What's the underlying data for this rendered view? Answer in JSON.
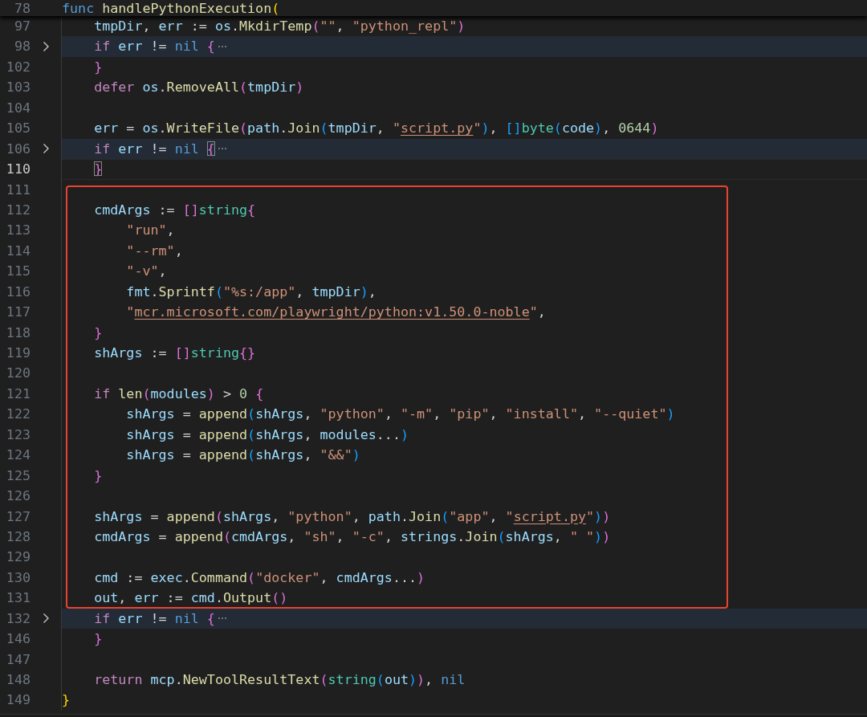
{
  "sticky_header": {
    "number": "78",
    "tokens": [
      {
        "text": "func ",
        "kind": "const"
      },
      {
        "text": "handlePythonExecution",
        "kind": "fn"
      },
      {
        "text": "(",
        "kind": "b1"
      }
    ]
  },
  "sections": [
    {
      "framed": false,
      "lines": [
        {
          "number": "97",
          "folded": false,
          "current": false,
          "tokens": [
            {
              "text": "    tmpDir",
              "kind": "var"
            },
            {
              "text": ", ",
              "kind": "plain"
            },
            {
              "text": "err",
              "kind": "var"
            },
            {
              "text": " := ",
              "kind": "plain"
            },
            {
              "text": "os",
              "kind": "var"
            },
            {
              "text": ".",
              "kind": "plain"
            },
            {
              "text": "MkdirTemp",
              "kind": "fn"
            },
            {
              "text": "(",
              "kind": "b2"
            },
            {
              "text": "\"\"",
              "kind": "str"
            },
            {
              "text": ", ",
              "kind": "plain"
            },
            {
              "text": "\"python_repl\"",
              "kind": "str"
            },
            {
              "text": ")",
              "kind": "b2"
            }
          ]
        },
        {
          "number": "98",
          "folded": true,
          "current": false,
          "tokens": [
            {
              "text": "    if ",
              "kind": "kw"
            },
            {
              "text": "err",
              "kind": "var"
            },
            {
              "text": " != ",
              "kind": "plain"
            },
            {
              "text": "nil ",
              "kind": "const"
            },
            {
              "text": "{",
              "kind": "b2"
            }
          ]
        },
        {
          "number": "102",
          "folded": false,
          "current": false,
          "tokens": [
            {
              "text": "    }",
              "kind": "b2"
            }
          ]
        },
        {
          "number": "103",
          "folded": false,
          "current": false,
          "tokens": [
            {
              "text": "    defer ",
              "kind": "kw"
            },
            {
              "text": "os",
              "kind": "var"
            },
            {
              "text": ".",
              "kind": "plain"
            },
            {
              "text": "RemoveAll",
              "kind": "fn"
            },
            {
              "text": "(",
              "kind": "b2"
            },
            {
              "text": "tmpDir",
              "kind": "var"
            },
            {
              "text": ")",
              "kind": "b2"
            }
          ]
        },
        {
          "number": "104",
          "folded": false,
          "current": false
        },
        {
          "number": "105",
          "folded": false,
          "current": false,
          "tokens": [
            {
              "text": "    err",
              "kind": "var"
            },
            {
              "text": " = ",
              "kind": "plain"
            },
            {
              "text": "os",
              "kind": "var"
            },
            {
              "text": ".",
              "kind": "plain"
            },
            {
              "text": "WriteFile",
              "kind": "fn"
            },
            {
              "text": "(",
              "kind": "b2"
            },
            {
              "text": "path",
              "kind": "var"
            },
            {
              "text": ".",
              "kind": "plain"
            },
            {
              "text": "Join",
              "kind": "fn"
            },
            {
              "text": "(",
              "kind": "b3"
            },
            {
              "text": "tmpDir",
              "kind": "var"
            },
            {
              "text": ", ",
              "kind": "plain"
            },
            {
              "text": "\"",
              "kind": "str"
            },
            {
              "text": "script.py",
              "kind": "link"
            },
            {
              "text": "\"",
              "kind": "str"
            },
            {
              "text": ")",
              "kind": "b3"
            },
            {
              "text": ", ",
              "kind": "plain"
            },
            {
              "text": "[]",
              "kind": "b3"
            },
            {
              "text": "byte",
              "kind": "type"
            },
            {
              "text": "(",
              "kind": "b3"
            },
            {
              "text": "code",
              "kind": "var"
            },
            {
              "text": ")",
              "kind": "b3"
            },
            {
              "text": ", ",
              "kind": "plain"
            },
            {
              "text": "0644",
              "kind": "num"
            },
            {
              "text": ")",
              "kind": "b2"
            }
          ]
        },
        {
          "number": "106",
          "folded": true,
          "current": false,
          "tokens": [
            {
              "text": "    if ",
              "kind": "kw"
            },
            {
              "text": "err",
              "kind": "var"
            },
            {
              "text": " != ",
              "kind": "plain"
            },
            {
              "text": "nil ",
              "kind": "const"
            },
            {
              "text": "{",
              "kind": "b2",
              "matched": true
            }
          ]
        },
        {
          "number": "110",
          "folded": false,
          "current": true,
          "tokens": [
            {
              "text": "    }",
              "kind": "b2",
              "matched": true
            }
          ]
        }
      ]
    },
    {
      "framed": true,
      "lines": [
        {
          "number": "111",
          "folded": false,
          "current": false
        },
        {
          "number": "112",
          "folded": false,
          "current": false,
          "tokens": [
            {
              "text": "    cmdArgs",
              "kind": "var"
            },
            {
              "text": " := ",
              "kind": "plain"
            },
            {
              "text": "[]",
              "kind": "b2"
            },
            {
              "text": "string",
              "kind": "type"
            },
            {
              "text": "{",
              "kind": "b2"
            }
          ]
        },
        {
          "number": "113",
          "folded": false,
          "current": false,
          "tokens": [
            {
              "text": "        \"run\"",
              "kind": "str"
            },
            {
              "text": ",",
              "kind": "plain"
            }
          ]
        },
        {
          "number": "114",
          "folded": false,
          "current": false,
          "tokens": [
            {
              "text": "        \"--rm\"",
              "kind": "str"
            },
            {
              "text": ",",
              "kind": "plain"
            }
          ]
        },
        {
          "number": "115",
          "folded": false,
          "current": false,
          "tokens": [
            {
              "text": "        \"-v\"",
              "kind": "str"
            },
            {
              "text": ",",
              "kind": "plain"
            }
          ]
        },
        {
          "number": "116",
          "folded": false,
          "current": false,
          "tokens": [
            {
              "text": "        fmt",
              "kind": "var"
            },
            {
              "text": ".",
              "kind": "plain"
            },
            {
              "text": "Sprintf",
              "kind": "fn"
            },
            {
              "text": "(",
              "kind": "b3"
            },
            {
              "text": "\"%s:/app\"",
              "kind": "str"
            },
            {
              "text": ", ",
              "kind": "plain"
            },
            {
              "text": "tmpDir",
              "kind": "var"
            },
            {
              "text": ")",
              "kind": "b3"
            },
            {
              "text": ",",
              "kind": "plain"
            }
          ]
        },
        {
          "number": "117",
          "folded": false,
          "current": false,
          "tokens": [
            {
              "text": "        \"",
              "kind": "str"
            },
            {
              "text": "mcr.microsoft.com/playwright/python:v1.50.0-noble",
              "kind": "link"
            },
            {
              "text": "\"",
              "kind": "str"
            },
            {
              "text": ",",
              "kind": "plain"
            }
          ]
        },
        {
          "number": "118",
          "folded": false,
          "current": false,
          "tokens": [
            {
              "text": "    }",
              "kind": "b2"
            }
          ]
        },
        {
          "number": "119",
          "folded": false,
          "current": false,
          "tokens": [
            {
              "text": "    shArgs",
              "kind": "var"
            },
            {
              "text": " := ",
              "kind": "plain"
            },
            {
              "text": "[]",
              "kind": "b2"
            },
            {
              "text": "string",
              "kind": "type"
            },
            {
              "text": "{}",
              "kind": "b2"
            }
          ]
        },
        {
          "number": "120",
          "folded": false,
          "current": false
        },
        {
          "number": "121",
          "folded": false,
          "current": false,
          "tokens": [
            {
              "text": "    if ",
              "kind": "kw"
            },
            {
              "text": "len",
              "kind": "fn"
            },
            {
              "text": "(",
              "kind": "b2"
            },
            {
              "text": "modules",
              "kind": "var"
            },
            {
              "text": ")",
              "kind": "b2"
            },
            {
              "text": " > ",
              "kind": "plain"
            },
            {
              "text": "0 ",
              "kind": "num"
            },
            {
              "text": "{",
              "kind": "b2"
            }
          ]
        },
        {
          "number": "122",
          "folded": false,
          "current": false,
          "tokens": [
            {
              "text": "        shArgs",
              "kind": "var"
            },
            {
              "text": " = ",
              "kind": "plain"
            },
            {
              "text": "append",
              "kind": "fn"
            },
            {
              "text": "(",
              "kind": "b3"
            },
            {
              "text": "shArgs",
              "kind": "var"
            },
            {
              "text": ", ",
              "kind": "plain"
            },
            {
              "text": "\"python\"",
              "kind": "str"
            },
            {
              "text": ", ",
              "kind": "plain"
            },
            {
              "text": "\"-m\"",
              "kind": "str"
            },
            {
              "text": ", ",
              "kind": "plain"
            },
            {
              "text": "\"pip\"",
              "kind": "str"
            },
            {
              "text": ", ",
              "kind": "plain"
            },
            {
              "text": "\"install\"",
              "kind": "str"
            },
            {
              "text": ", ",
              "kind": "plain"
            },
            {
              "text": "\"--quiet\"",
              "kind": "str"
            },
            {
              "text": ")",
              "kind": "b3"
            }
          ]
        },
        {
          "number": "123",
          "folded": false,
          "current": false,
          "tokens": [
            {
              "text": "        shArgs",
              "kind": "var"
            },
            {
              "text": " = ",
              "kind": "plain"
            },
            {
              "text": "append",
              "kind": "fn"
            },
            {
              "text": "(",
              "kind": "b3"
            },
            {
              "text": "shArgs",
              "kind": "var"
            },
            {
              "text": ", ",
              "kind": "plain"
            },
            {
              "text": "modules",
              "kind": "var"
            },
            {
              "text": "...",
              "kind": "plain"
            },
            {
              "text": ")",
              "kind": "b3"
            }
          ]
        },
        {
          "number": "124",
          "folded": false,
          "current": false,
          "tokens": [
            {
              "text": "        shArgs",
              "kind": "var"
            },
            {
              "text": " = ",
              "kind": "plain"
            },
            {
              "text": "append",
              "kind": "fn"
            },
            {
              "text": "(",
              "kind": "b3"
            },
            {
              "text": "shArgs",
              "kind": "var"
            },
            {
              "text": ", ",
              "kind": "plain"
            },
            {
              "text": "\"&&\"",
              "kind": "str"
            },
            {
              "text": ")",
              "kind": "b3"
            }
          ]
        },
        {
          "number": "125",
          "folded": false,
          "current": false,
          "tokens": [
            {
              "text": "    }",
              "kind": "b2"
            }
          ]
        },
        {
          "number": "126",
          "folded": false,
          "current": false
        },
        {
          "number": "127",
          "folded": false,
          "current": false,
          "tokens": [
            {
              "text": "    shArgs",
              "kind": "var"
            },
            {
              "text": " = ",
              "kind": "plain"
            },
            {
              "text": "append",
              "kind": "fn"
            },
            {
              "text": "(",
              "kind": "b2"
            },
            {
              "text": "shArgs",
              "kind": "var"
            },
            {
              "text": ", ",
              "kind": "plain"
            },
            {
              "text": "\"python\"",
              "kind": "str"
            },
            {
              "text": ", ",
              "kind": "plain"
            },
            {
              "text": "path",
              "kind": "var"
            },
            {
              "text": ".",
              "kind": "plain"
            },
            {
              "text": "Join",
              "kind": "fn"
            },
            {
              "text": "(",
              "kind": "b3"
            },
            {
              "text": "\"app\"",
              "kind": "str"
            },
            {
              "text": ", ",
              "kind": "plain"
            },
            {
              "text": "\"",
              "kind": "str"
            },
            {
              "text": "script.py",
              "kind": "link"
            },
            {
              "text": "\"",
              "kind": "str"
            },
            {
              "text": ")",
              "kind": "b3"
            },
            {
              "text": ")",
              "kind": "b2"
            }
          ]
        },
        {
          "number": "128",
          "folded": false,
          "current": false,
          "tokens": [
            {
              "text": "    cmdArgs",
              "kind": "var"
            },
            {
              "text": " = ",
              "kind": "plain"
            },
            {
              "text": "append",
              "kind": "fn"
            },
            {
              "text": "(",
              "kind": "b2"
            },
            {
              "text": "cmdArgs",
              "kind": "var"
            },
            {
              "text": ", ",
              "kind": "plain"
            },
            {
              "text": "\"sh\"",
              "kind": "str"
            },
            {
              "text": ", ",
              "kind": "plain"
            },
            {
              "text": "\"-c\"",
              "kind": "str"
            },
            {
              "text": ", ",
              "kind": "plain"
            },
            {
              "text": "strings",
              "kind": "var"
            },
            {
              "text": ".",
              "kind": "plain"
            },
            {
              "text": "Join",
              "kind": "fn"
            },
            {
              "text": "(",
              "kind": "b3"
            },
            {
              "text": "shArgs",
              "kind": "var"
            },
            {
              "text": ", ",
              "kind": "plain"
            },
            {
              "text": "\" \"",
              "kind": "str"
            },
            {
              "text": ")",
              "kind": "b3"
            },
            {
              "text": ")",
              "kind": "b2"
            }
          ]
        },
        {
          "number": "129",
          "folded": false,
          "current": false
        },
        {
          "number": "130",
          "folded": false,
          "current": false,
          "tokens": [
            {
              "text": "    cmd",
              "kind": "var"
            },
            {
              "text": " := ",
              "kind": "plain"
            },
            {
              "text": "exec",
              "kind": "var"
            },
            {
              "text": ".",
              "kind": "plain"
            },
            {
              "text": "Command",
              "kind": "fn"
            },
            {
              "text": "(",
              "kind": "b2"
            },
            {
              "text": "\"docker\"",
              "kind": "str"
            },
            {
              "text": ", ",
              "kind": "plain"
            },
            {
              "text": "cmdArgs",
              "kind": "var"
            },
            {
              "text": "...",
              "kind": "plain"
            },
            {
              "text": ")",
              "kind": "b2"
            }
          ]
        },
        {
          "number": "131",
          "folded": false,
          "current": false,
          "tokens": [
            {
              "text": "    out",
              "kind": "var"
            },
            {
              "text": ", ",
              "kind": "plain"
            },
            {
              "text": "err",
              "kind": "var"
            },
            {
              "text": " := ",
              "kind": "plain"
            },
            {
              "text": "cmd",
              "kind": "var"
            },
            {
              "text": ".",
              "kind": "plain"
            },
            {
              "text": "Output",
              "kind": "fn"
            },
            {
              "text": "()",
              "kind": "b2"
            }
          ]
        }
      ]
    },
    {
      "framed": false,
      "lines": [
        {
          "number": "132",
          "folded": true,
          "current": false,
          "tokens": [
            {
              "text": "    if ",
              "kind": "kw"
            },
            {
              "text": "err",
              "kind": "var"
            },
            {
              "text": " != ",
              "kind": "plain"
            },
            {
              "text": "nil ",
              "kind": "const"
            },
            {
              "text": "{",
              "kind": "b2"
            }
          ]
        },
        {
          "number": "146",
          "folded": false,
          "current": false,
          "tokens": [
            {
              "text": "    }",
              "kind": "b2"
            }
          ]
        },
        {
          "number": "147",
          "folded": false,
          "current": false
        },
        {
          "number": "148",
          "folded": false,
          "current": false,
          "tokens": [
            {
              "text": "    return ",
              "kind": "kw"
            },
            {
              "text": "mcp",
              "kind": "var"
            },
            {
              "text": ".",
              "kind": "plain"
            },
            {
              "text": "NewToolResultText",
              "kind": "fn"
            },
            {
              "text": "(",
              "kind": "b2"
            },
            {
              "text": "string",
              "kind": "type"
            },
            {
              "text": "(",
              "kind": "b3"
            },
            {
              "text": "out",
              "kind": "var"
            },
            {
              "text": ")",
              "kind": "b3"
            },
            {
              "text": ")",
              "kind": "b2"
            },
            {
              "text": ", ",
              "kind": "plain"
            },
            {
              "text": "nil",
              "kind": "const"
            }
          ]
        },
        {
          "number": "149",
          "folded": false,
          "current": false,
          "tokens": [
            {
              "text": "}",
              "kind": "b1"
            }
          ]
        }
      ]
    }
  ]
}
